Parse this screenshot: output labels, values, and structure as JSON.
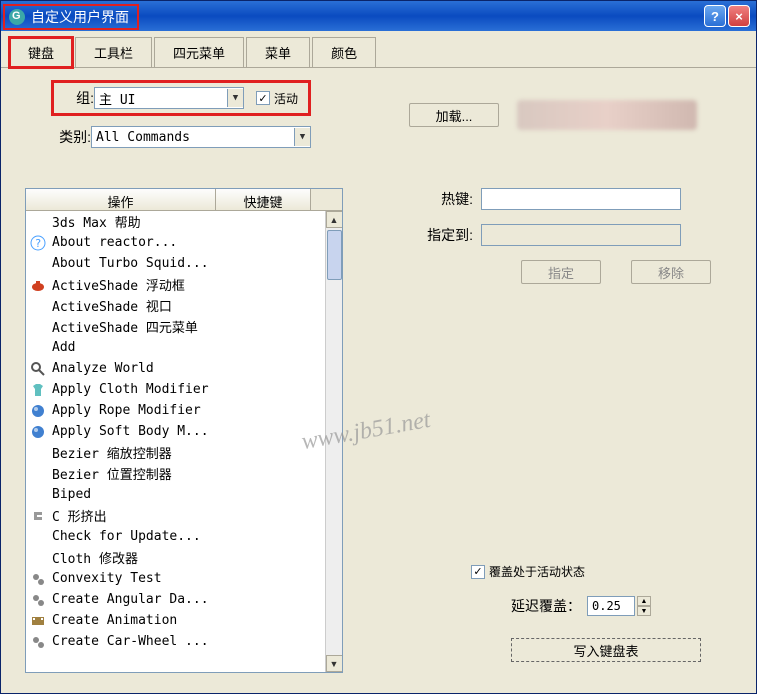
{
  "window": {
    "title": "自定义用户界面"
  },
  "tabs": {
    "keyboard": "键盘",
    "toolbar": "工具栏",
    "quad": "四元菜单",
    "menu": "菜单",
    "color": "颜色"
  },
  "group": {
    "label": "组:",
    "value": "主 UI",
    "active_label": "活动"
  },
  "category": {
    "label": "类别:",
    "value": "All Commands"
  },
  "columns": {
    "action": "操作",
    "shortcut": "快捷键"
  },
  "actions": [
    {
      "icon": "blank",
      "label": "3ds Max 帮助"
    },
    {
      "icon": "question",
      "label": "About reactor..."
    },
    {
      "icon": "blank",
      "label": "About Turbo Squid..."
    },
    {
      "icon": "teapot",
      "label": "ActiveShade 浮动框"
    },
    {
      "icon": "blank",
      "label": "ActiveShade 视口"
    },
    {
      "icon": "blank",
      "label": "ActiveShade 四元菜单"
    },
    {
      "icon": "blank",
      "label": "Add"
    },
    {
      "icon": "magnify",
      "label": "Analyze World"
    },
    {
      "icon": "shirt",
      "label": "Apply Cloth Modifier"
    },
    {
      "icon": "orb",
      "label": "Apply Rope Modifier"
    },
    {
      "icon": "orb",
      "label": "Apply Soft Body M..."
    },
    {
      "icon": "blank",
      "label": "Bezier 缩放控制器"
    },
    {
      "icon": "blank",
      "label": "Bezier 位置控制器"
    },
    {
      "icon": "blank",
      "label": "Biped"
    },
    {
      "icon": "c",
      "label": "C 形挤出"
    },
    {
      "icon": "blank",
      "label": "Check for Update..."
    },
    {
      "icon": "blank",
      "label": "Cloth 修改器"
    },
    {
      "icon": "gears",
      "label": "Convexity Test"
    },
    {
      "icon": "gears",
      "label": "Create Angular Da..."
    },
    {
      "icon": "film",
      "label": "Create Animation"
    },
    {
      "icon": "gears",
      "label": "Create Car-Wheel ..."
    }
  ],
  "side": {
    "hotkey_label": "热键:",
    "assigned_label": "指定到:",
    "assign_btn": "指定",
    "remove_btn": "移除"
  },
  "lower": {
    "override_label": "覆盖处于活动状态",
    "delay_label": "延迟覆盖：",
    "delay_value": "0.25",
    "write_btn": "写入键盘表",
    "load_btn": "加载..."
  },
  "watermark": "www.jb51.net"
}
